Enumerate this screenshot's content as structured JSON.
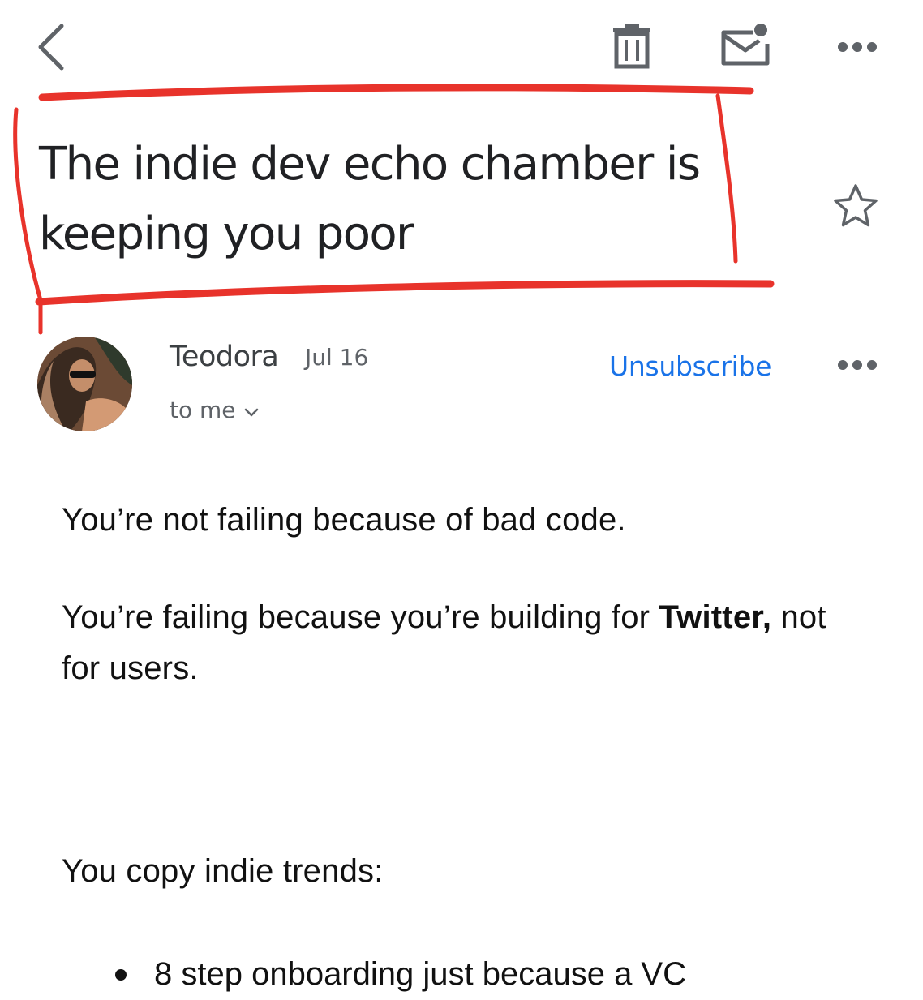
{
  "toolbar": {
    "back_icon": "chevron-left-icon",
    "delete_icon": "trash-icon",
    "mark_unread_icon": "mail-unread-icon",
    "more_icon": "more-horizontal-icon"
  },
  "email": {
    "subject": "The indie dev echo chamber is keeping you poor",
    "star_icon": "star-outline-icon",
    "sender": {
      "name": "Teodora",
      "date": "Jul 16",
      "recipient_label": "to me",
      "avatar_icon": "avatar-photo"
    },
    "unsubscribe_label": "Unsubscribe",
    "message_more_icon": "more-horizontal-icon",
    "body": {
      "p1": "You’re not failing because of bad code.",
      "p2_prefix": "You’re failing because you’re building for ",
      "p2_bold": "Twitter,",
      "p2_suffix": " not for users.",
      "p3": "You copy indie trends:",
      "bullets": [
        "8 step onboarding just because a VC"
      ]
    }
  },
  "annotation": {
    "color": "#e8332b"
  },
  "colors": {
    "link": "#1a73e8",
    "text_primary": "#202124",
    "text_secondary": "#5f6368",
    "icon": "#5f6368"
  }
}
